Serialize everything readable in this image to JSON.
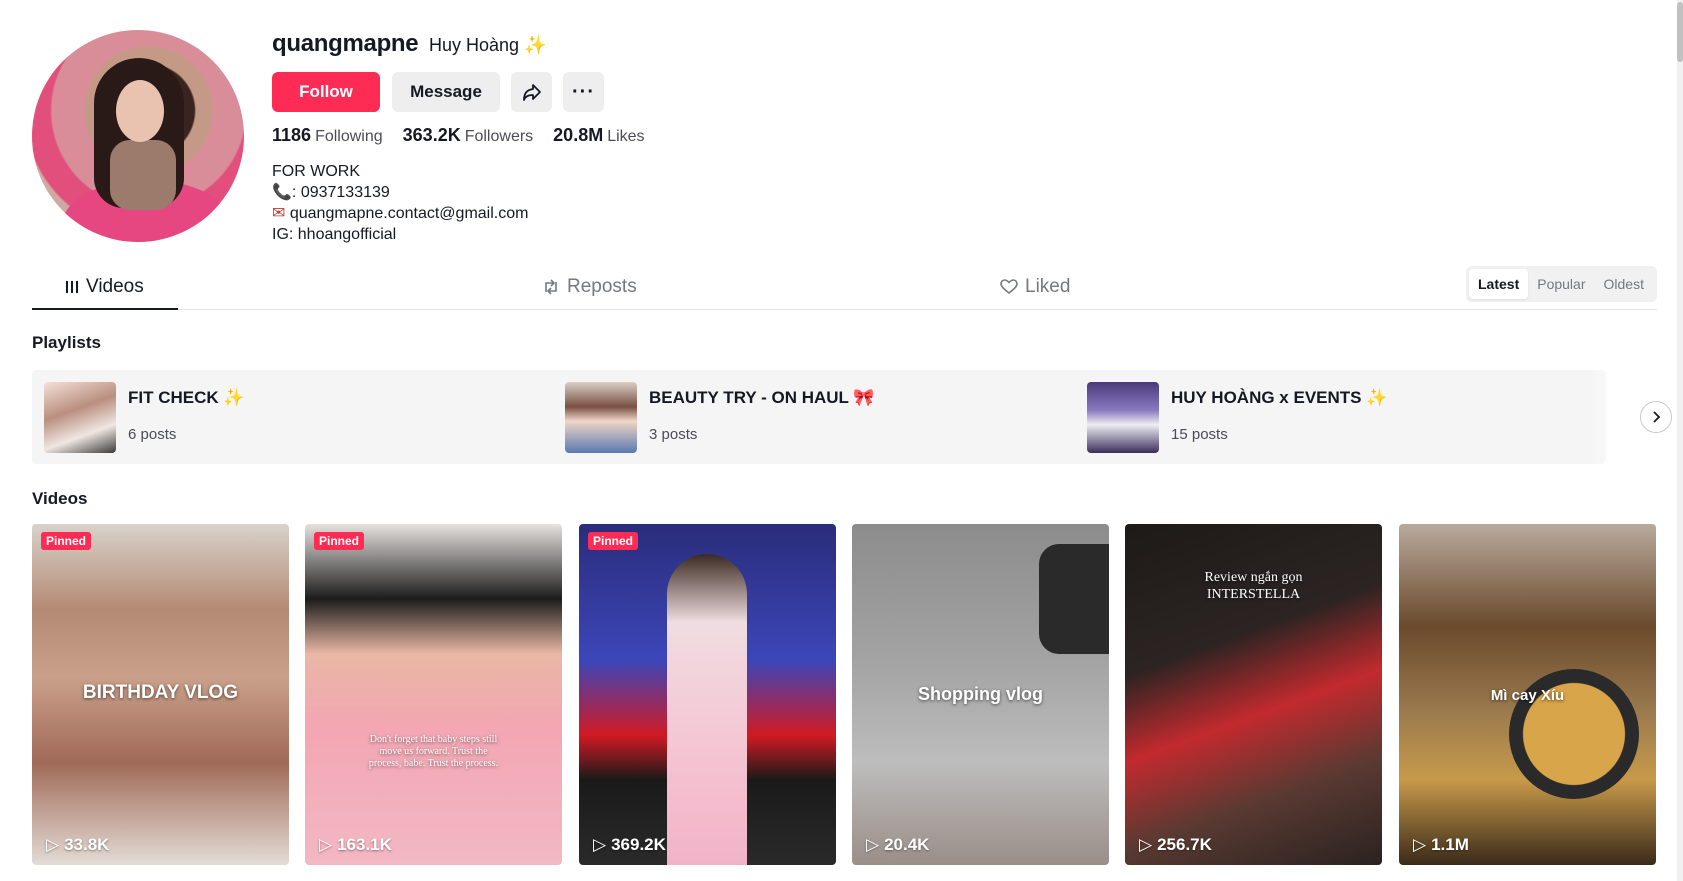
{
  "profile": {
    "username": "quangmapne",
    "nickname": "Huy Hoàng",
    "nickname_emoji": "✨",
    "follow_label": "Follow",
    "message_label": "Message",
    "more_label": "···"
  },
  "stats": {
    "following_count": "1186",
    "following_label": "Following",
    "followers_count": "363.2K",
    "followers_label": "Followers",
    "likes_count": "20.8M",
    "likes_label": "Likes"
  },
  "bio": {
    "line1": "FOR WORK",
    "phone": ": 0937133139",
    "email": "quangmapne.contact@gmail.com",
    "ig": "IG: hhoangofficial"
  },
  "tabs": [
    {
      "label": "Videos",
      "icon": "grid-icon",
      "active": true
    },
    {
      "label": "Reposts",
      "icon": "repost-icon",
      "active": false
    },
    {
      "label": "Liked",
      "icon": "heart-icon",
      "active": false
    }
  ],
  "sort": [
    "Latest",
    "Popular",
    "Oldest"
  ],
  "sections": {
    "playlists": "Playlists",
    "videos": "Videos"
  },
  "playlists": [
    {
      "name": "FIT CHECK",
      "emoji": "✨",
      "count": "6 posts"
    },
    {
      "name": "BEAUTY TRY - ON HAUL",
      "emoji": "🎀",
      "count": "3 posts"
    },
    {
      "name": "HUY HOÀNG x EVENTS",
      "emoji": "✨",
      "count": "15 posts"
    }
  ],
  "videos": [
    {
      "pinned": "Pinned",
      "views": "33.8K",
      "overlay": "BIRTHDAY VLOG"
    },
    {
      "pinned": "Pinned",
      "views": "163.1K",
      "overlay": "Don't forget that baby steps still move us forward. Trust the process, babe. Trust the process."
    },
    {
      "pinned": "Pinned",
      "views": "369.2K",
      "overlay": ""
    },
    {
      "pinned": "",
      "views": "20.4K",
      "overlay": "Shopping vlog"
    },
    {
      "pinned": "",
      "views": "256.7K",
      "overlay": "Review ngắn gọn INTERSTELLA"
    },
    {
      "pinned": "",
      "views": "1.1M",
      "overlay": "Mì cay Xíu"
    }
  ],
  "colors": {
    "accent": "#fe2c55",
    "text": "#161823",
    "muted": "#767880"
  }
}
